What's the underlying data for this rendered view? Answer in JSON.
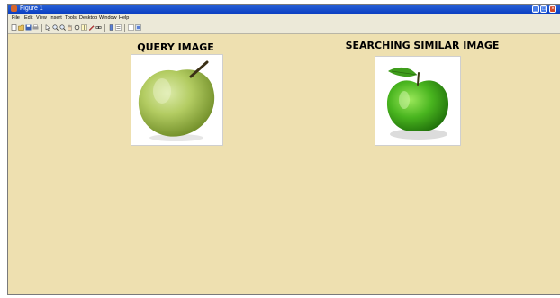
{
  "window": {
    "title": "Figure 1",
    "controls": [
      "_",
      "□",
      "×"
    ]
  },
  "menubar": [
    "File",
    "Edit",
    "View",
    "Insert",
    "Tools",
    "Desktop",
    "Window",
    "Help"
  ],
  "toolbar": {
    "icons": [
      "new-icon",
      "open-icon",
      "save-icon",
      "print-icon",
      "pointer-icon",
      "zoom-in-icon",
      "zoom-out-icon",
      "pan-icon",
      "rotate-icon",
      "datacursor-icon",
      "brush-icon",
      "link-icon",
      "colorbar-icon",
      "legend-icon",
      "hide-plot-icon",
      "show-plot-icon"
    ]
  },
  "figure": {
    "query_caption": "QUERY IMAGE",
    "result_caption": "SEARCHING SIMILAR IMAGE",
    "query_image": "yellow-green apple with stem",
    "result_image": "green apple with leaf",
    "background_color": "#eee0b0"
  }
}
